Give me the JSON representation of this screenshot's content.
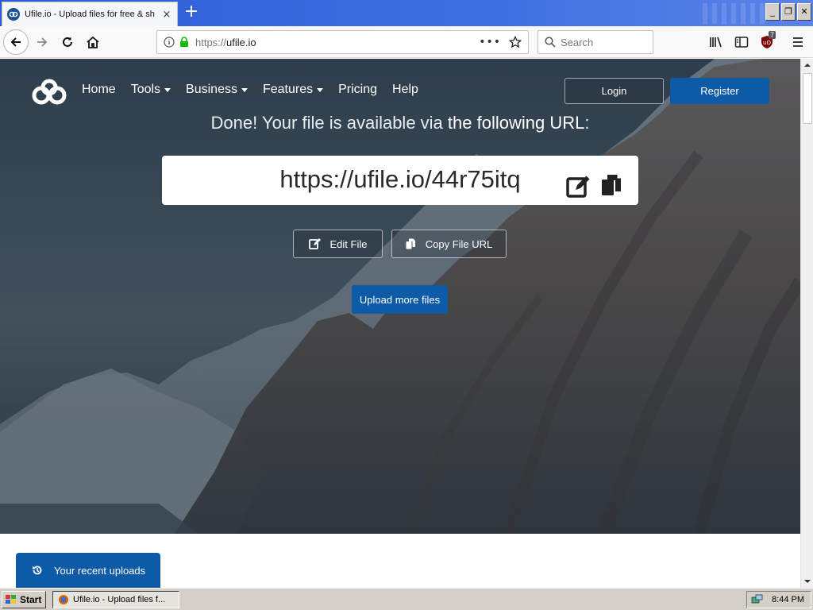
{
  "browser": {
    "tab_title": "Ufile.io - Upload files for free & sh",
    "tab_close": "×",
    "new_tab": "+",
    "url_protocol": "https://",
    "url_host": "ufile.io",
    "url_more": "•••",
    "search_placeholder": "Search",
    "ublock_count": "7"
  },
  "site": {
    "nav": {
      "home": "Home",
      "tools": "Tools",
      "business": "Business",
      "features": "Features",
      "pricing": "Pricing",
      "help": "Help"
    },
    "login_label": "Login",
    "register_label": "Register",
    "done_prefix": "Done! Your file is available via ",
    "done_strong": "the following URL",
    "done_suffix": ":",
    "file_url": "https://ufile.io/44r75itq",
    "edit_file_label": "Edit File",
    "copy_url_label": "Copy File URL",
    "upload_more_label": "Upload more files",
    "recent_uploads_label": "Your recent uploads"
  },
  "taskbar": {
    "start_label": "Start",
    "task_label": "Ufile.io - Upload files f...",
    "clock": "8:44 PM"
  },
  "colors": {
    "accent_blue": "#0d5aa7",
    "brand_tab_blue": "#2c5bd7"
  }
}
